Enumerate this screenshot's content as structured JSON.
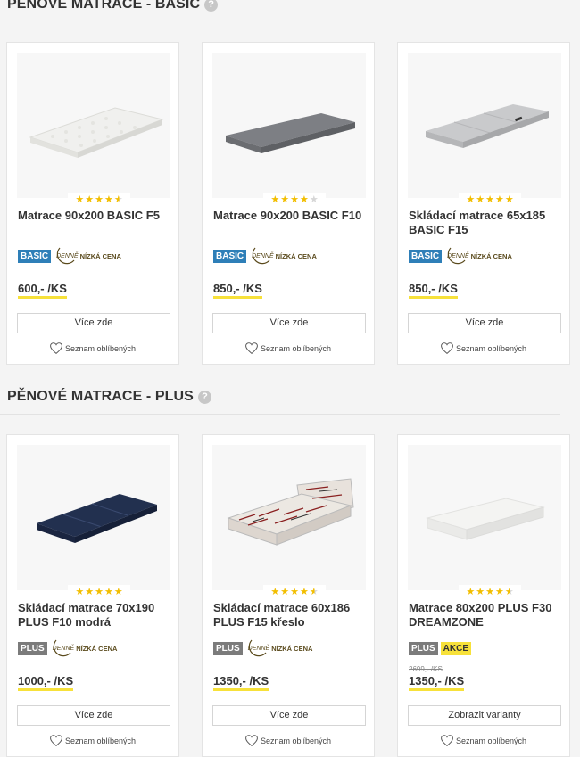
{
  "sections": [
    {
      "title": "PĚNOVÉ MATRACE - BASIC",
      "help": "?",
      "products": [
        {
          "name": "Matrace 90x200 BASIC F5",
          "badge": "BASIC",
          "daily_a": "DENNĚ",
          "daily_b": "NÍZKÁ CENA",
          "price": "600,- /KS",
          "rating": 4.5,
          "button": "Více zde",
          "fav": "Seznam oblíbených",
          "image": "white-eggcrate-mattress"
        },
        {
          "name": "Matrace 90x200 BASIC F10",
          "badge": "BASIC",
          "daily_a": "DENNĚ",
          "daily_b": "NÍZKÁ CENA",
          "price": "850,- /KS",
          "rating": 4,
          "button": "Více zde",
          "fav": "Seznam oblíbených",
          "image": "grey-mattress"
        },
        {
          "name": "Skládací matrace 65x185 BASIC F15",
          "badge": "BASIC",
          "daily_a": "DENNĚ",
          "daily_b": "NÍZKÁ CENA",
          "price": "850,- /KS",
          "rating": 5,
          "button": "Více zde",
          "fav": "Seznam oblíbených",
          "image": "light-grey-folding-mattress"
        }
      ]
    },
    {
      "title": "PĚNOVÉ MATRACE - PLUS",
      "help": "?",
      "products": [
        {
          "name": "Skládací matrace 70x190 PLUS F10 modrá",
          "badge": "PLUS",
          "daily_a": "DENNĚ",
          "daily_b": "NÍZKÁ CENA",
          "price": "1000,- /KS",
          "rating": 5,
          "button": "Více zde",
          "fav": "Seznam oblíbených",
          "image": "blue-folding-mattress"
        },
        {
          "name": "Skládací matrace 60x186 PLUS F15 křeslo",
          "badge": "PLUS",
          "daily_a": "DENNĚ",
          "daily_b": "NÍZKÁ CENA",
          "price": "1350,- /KS",
          "rating": 4.5,
          "button": "Více zde",
          "fav": "Seznam oblíbených",
          "image": "patterned-chair-mattress"
        },
        {
          "name": "Matrace 80x200 PLUS F30 DREAMZONE",
          "badge": "PLUS",
          "badge2": "AKCE",
          "old_price": "2699,- /KS",
          "price": "1350,- /KS",
          "rating": 4.5,
          "button": "Zobrazit varianty",
          "fav": "Seznam oblíbených",
          "image": "white-thick-mattress"
        }
      ]
    }
  ],
  "colors": {
    "basic_badge": "#2e7fb8",
    "plus_badge": "#7b7b7b",
    "akce_badge": "#f7e13a",
    "price_underline": "#f7e13a",
    "star": "#f2be00"
  }
}
